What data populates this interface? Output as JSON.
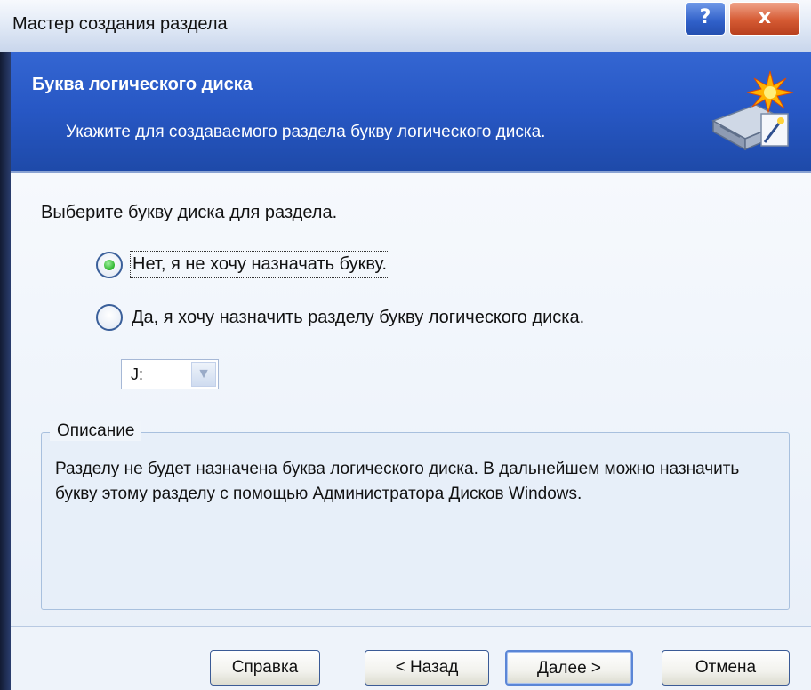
{
  "window": {
    "title": "Мастер создания раздела",
    "help_glyph": "?",
    "close_glyph": "x"
  },
  "header": {
    "title": "Буква логического диска",
    "subtitle": "Укажите для создаваемого раздела букву логического диска.",
    "icon": "disk-wizard-icon"
  },
  "content": {
    "prompt": "Выберите букву диска для раздела.",
    "options": [
      {
        "label": "Нет, я не хочу назначать букву.",
        "selected": true
      },
      {
        "label": "Да, я хочу назначить разделу букву логического диска.",
        "selected": false
      }
    ],
    "drive_letter": "J:",
    "description": {
      "legend": "Описание",
      "text": "Разделу не будет назначена буква логического диска. В дальнейшем можно назначить букву этому разделу с помощью Администратора Дисков Windows."
    }
  },
  "buttons": {
    "help": "Справка",
    "back": "< Назад",
    "next": "Далее >",
    "cancel": "Отмена"
  },
  "colors": {
    "header_blue": "#2757c4",
    "radio_selected": "#2cb52c",
    "close_red": "#d55a33"
  }
}
